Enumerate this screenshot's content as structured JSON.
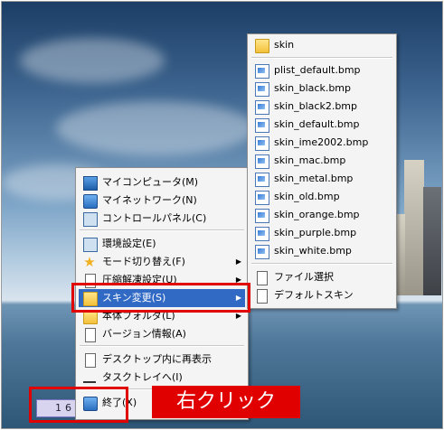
{
  "main_menu": {
    "items": [
      {
        "label": "マイコンピュータ(M)",
        "icon": "computer-icon"
      },
      {
        "label": "マイネットワーク(N)",
        "icon": "network-icon"
      },
      {
        "label": "コントロールパネル(C)",
        "icon": "control-panel-icon"
      },
      {
        "label": "環境設定(E)",
        "icon": "settings-icon"
      },
      {
        "label": "モード切り替え(F)",
        "icon": "star-icon",
        "submenu": true
      },
      {
        "label": "圧縮解凍設定(U)",
        "icon": "document-icon",
        "submenu": true
      },
      {
        "label": "スキン変更(S)",
        "icon": "folder-icon",
        "submenu": true,
        "highlighted": true
      },
      {
        "label": "本体フォルダ(L)",
        "icon": "folder-icon",
        "submenu": true
      },
      {
        "label": "バージョン情報(A)",
        "icon": "window-icon"
      },
      {
        "label": "デスクトップ内に再表示",
        "icon": "window-icon"
      },
      {
        "label": "タスクトレイへ(I)",
        "icon": "minimize-icon"
      },
      {
        "label": "終了(X)",
        "icon": "exit-door-icon"
      }
    ]
  },
  "skin_menu": {
    "folder": "skin",
    "files": [
      "plist_default.bmp",
      "skin_black.bmp",
      "skin_black2.bmp",
      "skin_default.bmp",
      "skin_ime2002.bmp",
      "skin_mac.bmp",
      "skin_metal.bmp",
      "skin_old.bmp",
      "skin_orange.bmp",
      "skin_purple.bmp",
      "skin_white.bmp"
    ],
    "actions": [
      "ファイル選択",
      "デフォルトスキン"
    ]
  },
  "taskbar": {
    "tray_value": "16"
  },
  "annotation": {
    "label": "右クリック",
    "color": "#e00000"
  },
  "colors": {
    "highlight": "#316ac5"
  }
}
